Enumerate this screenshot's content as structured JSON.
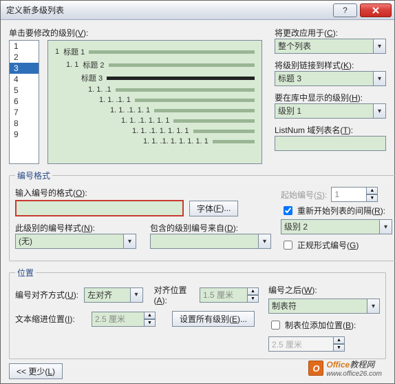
{
  "window": {
    "title": "定义新多级列表"
  },
  "labels": {
    "clickLevel": "单击要修改的级别",
    "clickLevel_u": "V",
    "applyTo": "将更改应用于",
    "applyTo_u": "C",
    "linkStyle": "将级别链接到样式",
    "linkStyle_u": "K",
    "showLevel": "要在库中显示的级别",
    "showLevel_u": "H",
    "listnum": "ListNum 域列表名",
    "listnum_u": "T",
    "formatLegend": "编号格式",
    "enterFormat": "输入编号的格式",
    "enterFormat_u": "O",
    "fontBtn": "字体",
    "fontBtn_u": "F",
    "levelStyle": "此级别的编号样式",
    "levelStyle_u": "N",
    "includeFrom": "包含的级别编号来自",
    "includeFrom_u": "D",
    "startAt": "起始编号",
    "startAt_u": "S",
    "restart": "重新开始列表的间隔",
    "restart_u": "R",
    "legal": "正规形式编号",
    "legal_u": "G",
    "posLegend": "位置",
    "align": "编号对齐方式",
    "align_u": "U",
    "alignAt": "对齐位置",
    "alignAt_u": "A",
    "indent": "文本缩进位置",
    "indent_u": "I",
    "setAll": "设置所有级别",
    "setAll_u": "E",
    "follow": "编号之后",
    "follow_u": "W",
    "tabAdd": "制表位添加位置",
    "tabAdd_u": "B",
    "less": "<< 更少",
    "less_u": "L"
  },
  "values": {
    "levels": [
      "1",
      "2",
      "3",
      "4",
      "5",
      "6",
      "7",
      "8",
      "9"
    ],
    "selectedLevel": "3",
    "applyTo": "整个列表",
    "linkStyle": "标题 3",
    "showLevel": "级别 1",
    "listnum": "",
    "format": "",
    "levelStyle": "(无)",
    "includeFrom": "",
    "startAt": "1",
    "restart": "级别 2",
    "restartChecked": true,
    "legalChecked": false,
    "align": "左对齐",
    "alignAt": "1.5 厘米",
    "indent": "2.5 厘米",
    "follow": "制表符",
    "tabAddChecked": false,
    "tabAdd": "2.5 厘米"
  },
  "preview": {
    "rows": [
      {
        "indent": 0,
        "num": "1",
        "label": "标题 1",
        "dark": false
      },
      {
        "indent": 1,
        "num": "1. 1",
        "label": "标题 2",
        "dark": false
      },
      {
        "indent": 2,
        "num": "",
        "label": "标题 3",
        "dark": true
      },
      {
        "indent": 3,
        "num": "1. 1. .1",
        "label": "",
        "dark": false
      },
      {
        "indent": 4,
        "num": "1. 1. .1. 1",
        "label": "",
        "dark": false
      },
      {
        "indent": 5,
        "num": "1. 1. .1. 1. 1",
        "label": "",
        "dark": false
      },
      {
        "indent": 6,
        "num": "1. 1. .1. 1. 1. 1",
        "label": "",
        "dark": false
      },
      {
        "indent": 7,
        "num": "1. 1. .1. 1. 1. 1. 1",
        "label": "",
        "dark": false
      },
      {
        "indent": 8,
        "num": "1. 1. .1. 1. 1. 1. 1. 1",
        "label": "",
        "dark": false
      }
    ]
  },
  "watermark": {
    "brand": "Office",
    "suffix": "教程网",
    "url": "www.office26.com"
  }
}
